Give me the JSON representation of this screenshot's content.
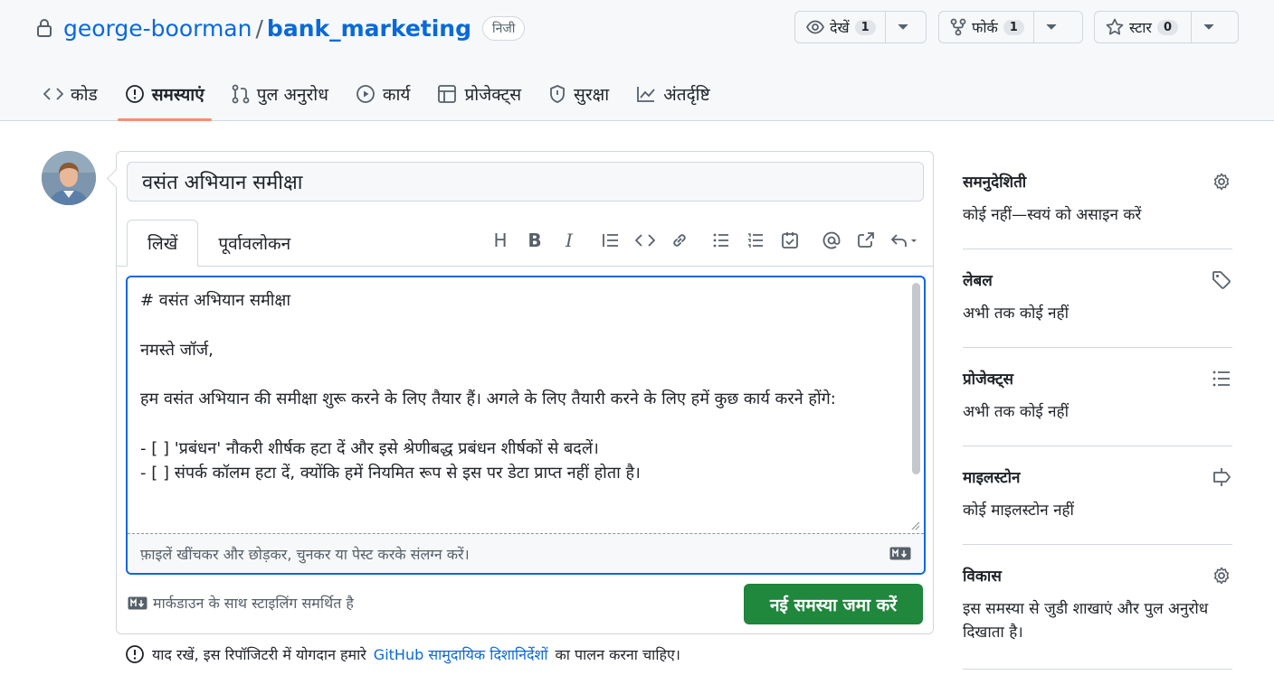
{
  "repo": {
    "owner": "george-boorman",
    "slash": "/",
    "name": "bank_marketing",
    "visibility": "निजी"
  },
  "header_buttons": {
    "watch": {
      "label": "देखें",
      "count": "1"
    },
    "fork": {
      "label": "फोर्क",
      "count": "1"
    },
    "star": {
      "label": "स्टार",
      "count": "0"
    }
  },
  "nav_tabs": [
    {
      "label": "कोड",
      "icon": "code-icon"
    },
    {
      "label": "समस्याएं",
      "icon": "issue-opened-icon",
      "active": true
    },
    {
      "label": "पुल अनुरोध",
      "icon": "git-pull-request-icon"
    },
    {
      "label": "कार्य",
      "icon": "play-icon"
    },
    {
      "label": "प्रोजेक्ट्स",
      "icon": "table-icon"
    },
    {
      "label": "सुरक्षा",
      "icon": "shield-icon"
    },
    {
      "label": "अंतर्दृष्टि",
      "icon": "graph-icon"
    }
  ],
  "issue_form": {
    "title_value": "वसंत अभियान समीक्षा",
    "tab_write": "लिखें",
    "tab_preview": "पूर्वावलोकन",
    "toolbar": {
      "heading": "H",
      "bold": "B",
      "italic": "I"
    },
    "body": "# वसंत अभियान समीक्षा\n\nनमस्ते जॉर्ज,\n\nहम वसंत अभियान की समीक्षा शुरू करने के लिए तैयार हैं। अगले के लिए तैयारी करने के लिए हमें कुछ कार्य करने होंगे:\n\n- [ ] 'प्रबंधन' नौकरी शीर्षक हटा दें और इसे श्रेणीबद्ध प्रबंधन शीर्षकों से बदलें।\n- [ ] संपर्क कॉलम हटा दें, क्योंकि हमें नियमित रूप से इस पर डेटा प्राप्त नहीं होता है।",
    "attach_hint": "फ़ाइलें खींचकर और छोड़कर, चुनकर या पेस्ट करके संलग्न करें।",
    "markdown_note": "मार्कडाउन के साथ स्टाइलिंग समर्थित है",
    "submit_label": "नई समस्या जमा करें"
  },
  "footer_note": {
    "prefix": "याद रखें, इस रिपॉजिटरी में योगदान हमारे",
    "link": "GitHub सामुदायिक दिशानिर्देशों",
    "suffix": "का पालन करना चाहिए।"
  },
  "sidebar": [
    {
      "heading": "समनुदेशिती",
      "value": "कोई नहीं—स्वयं को असाइन करें",
      "icon": "gear-icon"
    },
    {
      "heading": "लेबल",
      "value": "अभी तक कोई नहीं",
      "icon": "tag-icon"
    },
    {
      "heading": "प्रोजेक्ट्स",
      "value": "अभी तक कोई नहीं",
      "icon": "list-icon"
    },
    {
      "heading": "माइलस्टोन",
      "value": "कोई माइलस्टोन नहीं",
      "icon": "milestone-icon"
    },
    {
      "heading": "विकास",
      "value": "इस समस्या से जुडी शाखाएं और पुल अनुरोध दिखाता है।",
      "icon": "gear-icon"
    }
  ],
  "colors": {
    "accent": "#0969da",
    "submit": "#1f883d",
    "tab_underline": "#fd8c73"
  }
}
